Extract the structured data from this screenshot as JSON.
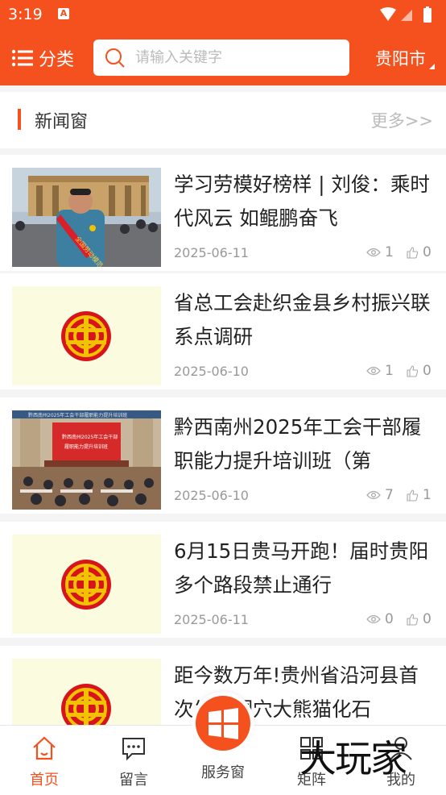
{
  "status_bar": {
    "time": "3:19",
    "notif_letter": "A"
  },
  "header": {
    "menu_label": "分类",
    "search_placeholder": "请输入关键字",
    "city": "贵阳市"
  },
  "section": {
    "title": "新闻窗",
    "more": "更多>>"
  },
  "news": [
    {
      "title": "学习劳模好榜样 | 刘俊：乘时代风云 如鲲鹏奋飞",
      "date": "2025-06-11",
      "views": "1",
      "likes": "0",
      "thumb": "photo-person"
    },
    {
      "title": "省总工会赴织金县乡村振兴联系点调研",
      "date": "2025-06-10",
      "views": "1",
      "likes": "0",
      "thumb": "union-logo"
    },
    {
      "title": "黔西南州2025年工会干部履职能力提升培训班（第",
      "date": "2025-06-10",
      "views": "7",
      "likes": "1",
      "thumb": "photo-meeting"
    },
    {
      "title": "6月15日贵马开跑！届时贵阳多个路段禁止通行",
      "date": "2025-06-11",
      "views": "0",
      "likes": "0",
      "thumb": "union-logo"
    },
    {
      "title": "距今数万年!贵州省沿河县首次发现洞穴大熊猫化石",
      "date": "",
      "views": "",
      "likes": "",
      "thumb": "union-logo"
    }
  ],
  "bottom_nav": {
    "home": "首页",
    "message": "留言",
    "service": "服务窗",
    "matrix": "矩阵",
    "mine": "我的"
  },
  "watermark": "大玩家",
  "colors": {
    "accent": "#f4511e",
    "logo_bg": "#fbfbe0",
    "logo_red": "#d7141a",
    "logo_gold": "#f2c200"
  }
}
